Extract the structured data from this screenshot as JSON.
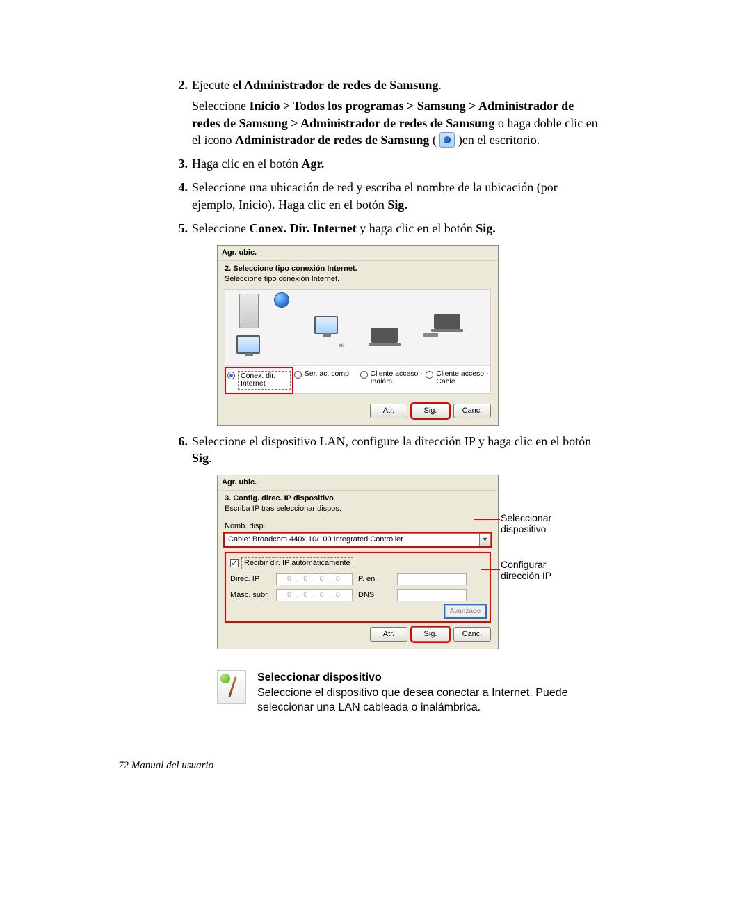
{
  "steps": {
    "s2": {
      "num": "2.",
      "lead": "Ejecute ",
      "bold1": "el Administrador de redes de Samsung",
      "tail1": ".",
      "p2a": "Seleccione ",
      "p2b": "Inicio > Todos los programas > Samsung > Administrador de redes de Samsung > Administrador de redes de Samsung",
      "p2c": " o haga doble clic en el icono ",
      "p2d": "Administrador de redes de Samsung",
      "p2e": " ( ",
      "p2f": " )en el escritorio."
    },
    "s3": {
      "num": "3.",
      "a": "Haga clic en el botón ",
      "b": "Agr."
    },
    "s4": {
      "num": "4.",
      "a": "Seleccione una ubicación de red y escriba el nombre de la ubicación (por ejemplo, Inicio). Haga clic en el botón ",
      "b": "Sig."
    },
    "s5": {
      "num": "5.",
      "a": "Seleccione ",
      "b": "Conex. Dir. Internet",
      "c": " y haga clic en el botón ",
      "d": "Sig."
    },
    "s6": {
      "num": "6.",
      "a": "Seleccione el dispositivo LAN, configure la dirección IP y haga clic en el botón ",
      "b": "Sig",
      "c": "."
    }
  },
  "wizard1": {
    "title": "Agr. ubic.",
    "h1": "2. Seleccione tipo conexión Internet.",
    "sub": "Seleccione tipo conexión Internet.",
    "radios": {
      "r1": "Conex. dir. Internet",
      "r2": "Ser. ac. comp.",
      "r3": "Cliente acceso - Inalám.",
      "r4": "Cliente acceso - Cable"
    },
    "buttons": {
      "back": "Atr.",
      "next": "Sig.",
      "cancel": "Canc."
    }
  },
  "wizard2": {
    "title": "Agr. ubic.",
    "h1": "3. Config. direc. IP dispositivo",
    "sub": "Escriba IP tras seleccionar dispos.",
    "deviceLabel": "Nomb. disp.",
    "deviceValue": "Cable: Broadcom 440x 10/100 Integrated Controller",
    "chkLabel": "Recibir dir. IP automáticamente",
    "labels": {
      "ip": "Direc. IP",
      "mask": "Másc. subr.",
      "gw": "P. enl.",
      "dns": "DNS"
    },
    "ipPlaceholder": "0 . 0 . 0 . 0",
    "advanced": "Avanzado",
    "buttons": {
      "back": "Atr.",
      "next": "Sig.",
      "cancel": "Canc."
    }
  },
  "legends": {
    "l1": "Seleccionar dispositivo",
    "l2": "Configurar dirección IP"
  },
  "note": {
    "title": "Seleccionar dispositivo",
    "body": "Seleccione el dispositivo que desea conectar a Internet. Puede seleccionar una LAN cableada o inalámbrica."
  },
  "footer": "72  Manual del usuario"
}
